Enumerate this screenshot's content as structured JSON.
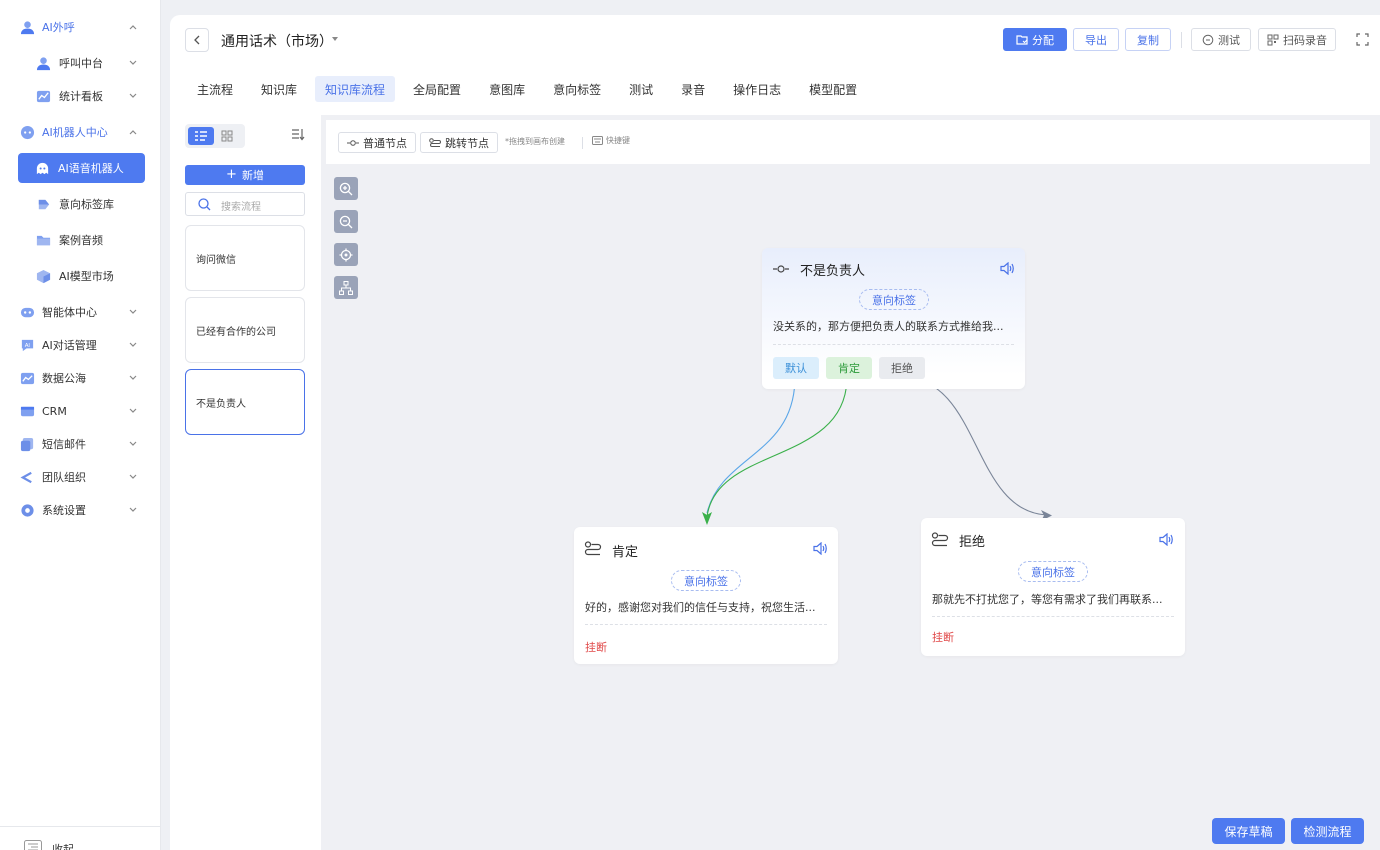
{
  "sidebar": {
    "items": [
      {
        "label": "AI外呼",
        "icon": "user-icon"
      },
      {
        "label": "呼叫中台",
        "icon": "user-icon"
      },
      {
        "label": "统计看板",
        "icon": "chart-icon"
      },
      {
        "label": "AI机器人中心",
        "icon": "robot-icon"
      },
      {
        "label": "AI语音机器人",
        "icon": "robot-icon"
      },
      {
        "label": "意向标签库",
        "icon": "tag-icon"
      },
      {
        "label": "案例音频",
        "icon": "folder-icon"
      },
      {
        "label": "AI模型市场",
        "icon": "cube-icon"
      },
      {
        "label": "智能体中心",
        "icon": "agent-icon"
      },
      {
        "label": "AI对话管理",
        "icon": "chat-icon"
      },
      {
        "label": "数据公海",
        "icon": "data-icon"
      },
      {
        "label": "CRM",
        "icon": "crm-icon"
      },
      {
        "label": "短信邮件",
        "icon": "sms-icon"
      },
      {
        "label": "团队组织",
        "icon": "team-icon"
      },
      {
        "label": "系统设置",
        "icon": "gear-icon"
      }
    ],
    "collapse_label": "收起"
  },
  "header": {
    "title": "通用话术（市场）",
    "buttons": {
      "assign": "分配",
      "export": "导出",
      "copy": "复制",
      "test": "测试",
      "scan_record": "扫码录音"
    }
  },
  "tabs": [
    "主流程",
    "知识库",
    "知识库流程",
    "全局配置",
    "意图库",
    "意向标签",
    "测试",
    "录音",
    "操作日志",
    "模型配置"
  ],
  "active_tab": "知识库流程",
  "list": {
    "add_label": "新增",
    "search_placeholder": "搜索流程",
    "flows": [
      "询问微信",
      "已经有合作的公司",
      "不是负责人"
    ],
    "selected": "不是负责人"
  },
  "canvas": {
    "toolbar": {
      "normal_node": "普通节点",
      "jump_node": "跳转节点",
      "hint": "*拖拽到画布创建",
      "shortcuts": "快捷键"
    },
    "nodes": {
      "root": {
        "title": "不是负责人",
        "tag": "意向标签",
        "text": "没关系的，那方便把负责人的联系方式推给我...",
        "branches": [
          "默认",
          "肯定",
          "拒绝"
        ]
      },
      "affirm": {
        "title": "肯定",
        "tag": "意向标签",
        "text": "好的，感谢您对我们的信任与支持，祝您生活...",
        "action": "挂断"
      },
      "reject": {
        "title": "拒绝",
        "tag": "意向标签",
        "text": "那就先不打扰您了，等您有需求了我们再联系...",
        "action": "挂断"
      }
    }
  },
  "footer": {
    "save_draft": "保存草稿",
    "check_flow": "检测流程"
  },
  "colors": {
    "primary": "#4e7af0",
    "default_branch": "#5aa6e8",
    "affirm_branch": "#3ab04a",
    "reject_branch": "#7a8598",
    "hangup": "#e04848"
  }
}
